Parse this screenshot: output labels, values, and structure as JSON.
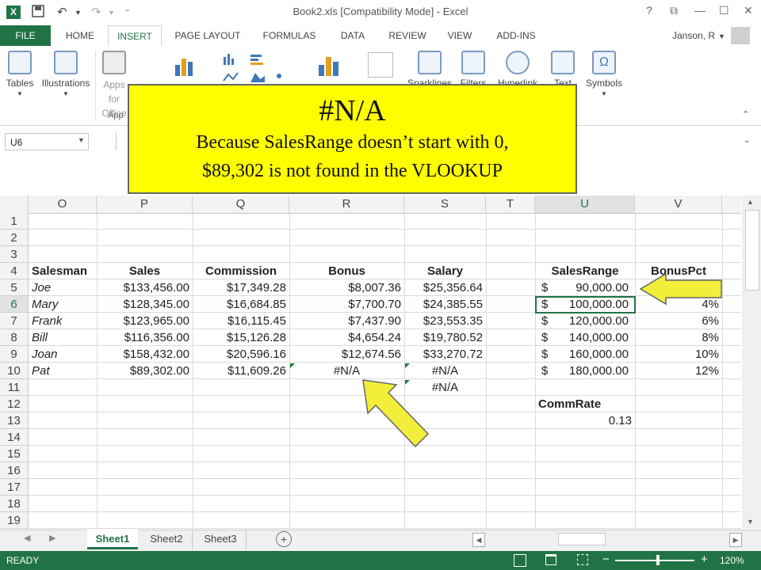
{
  "window": {
    "title": "Book2.xls  [Compatibility Mode] - Excel",
    "user": "Janson, R"
  },
  "tabs": [
    "FILE",
    "HOME",
    "INSERT",
    "PAGE LAYOUT",
    "FORMULAS",
    "DATA",
    "REVIEW",
    "VIEW",
    "ADD-INS"
  ],
  "active_tab": "INSERT",
  "ribbon": {
    "tables": "Tables",
    "illustrations": "Illustrations",
    "apps_for_office": "Apps for Office",
    "apps_group_label": "App",
    "symbols": "Symbols",
    "sparklines": "Sparklines",
    "filters": "Filters",
    "hyperlink": "Hyperlink",
    "text": "Text"
  },
  "formula_bar": {
    "name_box": "U6",
    "name_box_arrow": "▼"
  },
  "columns": [
    "O",
    "P",
    "Q",
    "R",
    "S",
    "T",
    "U",
    "V"
  ],
  "rows": [
    "1",
    "2",
    "3",
    "4",
    "5",
    "6",
    "7",
    "8",
    "9",
    "10",
    "11",
    "12",
    "13",
    "14",
    "15",
    "16",
    "17",
    "18",
    "19"
  ],
  "cells": {
    "headers": {
      "salesman": "Salesman",
      "sales": "Sales",
      "commission": "Commission",
      "bonus": "Bonus",
      "salary": "Salary",
      "salesrange": "SalesRange",
      "bonuspct": "BonusPct"
    },
    "people": [
      {
        "name": "Joe",
        "sales": "$133,456.00",
        "commission": "$17,349.28",
        "bonus": "$8,007.36",
        "salary": "$25,356.64"
      },
      {
        "name": "Mary",
        "sales": "$128,345.00",
        "commission": "$16,684.85",
        "bonus": "$7,700.70",
        "salary": "$24,385.55"
      },
      {
        "name": "Frank",
        "sales": "$123,965.00",
        "commission": "$16,115.45",
        "bonus": "$7,437.90",
        "salary": "$23,553.35"
      },
      {
        "name": "Bill",
        "sales": "$116,356.00",
        "commission": "$15,126.28",
        "bonus": "$4,654.24",
        "salary": "$19,780.52"
      },
      {
        "name": "Joan",
        "sales": "$158,432.00",
        "commission": "$20,596.16",
        "bonus": "$12,674.56",
        "salary": "$33,270.72"
      },
      {
        "name": "Pat",
        "sales": "$89,302.00",
        "commission": "$11,609.26",
        "bonus": "#N/A",
        "salary": "#N/A"
      }
    ],
    "s11": "#N/A",
    "ranges": [
      {
        "sym": "$",
        "amt": "90,000.00",
        "pct": ""
      },
      {
        "sym": "$",
        "amt": "100,000.00",
        "pct": "4%"
      },
      {
        "sym": "$",
        "amt": "120,000.00",
        "pct": "6%"
      },
      {
        "sym": "$",
        "amt": "140,000.00",
        "pct": "8%"
      },
      {
        "sym": "$",
        "amt": "160,000.00",
        "pct": "10%"
      },
      {
        "sym": "$",
        "amt": "180,000.00",
        "pct": "12%"
      }
    ],
    "commrate_label": "CommRate",
    "commrate_value": "0.13"
  },
  "sheets": [
    "Sheet1",
    "Sheet2",
    "Sheet3"
  ],
  "active_sheet": "Sheet1",
  "status": {
    "mode": "READY",
    "zoom": "120%"
  },
  "callout": {
    "title": "#N/A",
    "line1": "Because SalesRange doesn’t start with 0,",
    "line2": "$89,302 is not found in the VLOOKUP"
  },
  "colors": {
    "excel_green": "#217346",
    "callout": "#ffff00",
    "arrow": "#f2ee3a"
  }
}
